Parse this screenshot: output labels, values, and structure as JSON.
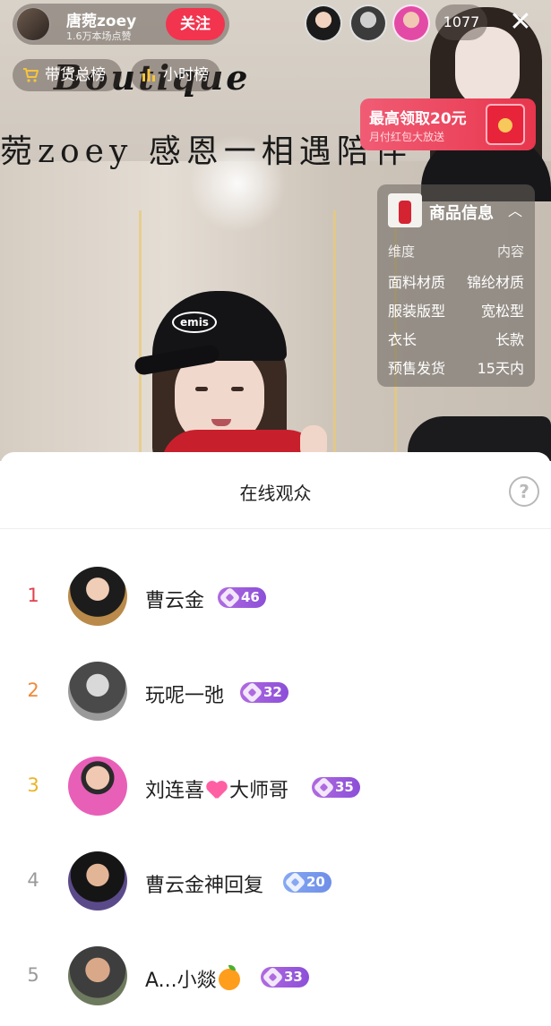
{
  "host": {
    "name": "唐菀zoey",
    "likes": "1.6万本场点赞",
    "follow_label": "关注"
  },
  "top_bar": {
    "viewer_count": "1077",
    "close_glyph": "✕"
  },
  "rank_pills": [
    {
      "label": "带货总榜",
      "icon": "cart-icon"
    },
    {
      "label": "小时榜",
      "icon": "bar-chart-icon"
    }
  ],
  "banner": {
    "script_title": "Boutique",
    "hand_text": "菀zoey 感恩一相遇陪伴"
  },
  "red_packet": {
    "title": "最高领取20元",
    "subtitle": "月付红包大放送"
  },
  "product": {
    "title": "商品信息",
    "header": {
      "k": "维度",
      "v": "内容"
    },
    "specs": [
      {
        "k": "面料材质",
        "v": "锦纶材质"
      },
      {
        "k": "服装版型",
        "v": "宽松型"
      },
      {
        "k": "衣长",
        "v": "长款"
      },
      {
        "k": "预售发货",
        "v": "15天内"
      }
    ]
  },
  "presenter": {
    "cap_text": "emis"
  },
  "audience": {
    "title": "在线观众",
    "help_glyph": "?",
    "rows": [
      {
        "rank": "1",
        "name": "曹云金",
        "level": "46",
        "badge": "purple",
        "rank_color": "#e0424f"
      },
      {
        "rank": "2",
        "name": "玩呢一弛",
        "level": "32",
        "badge": "purple",
        "rank_color": "#ef8a3a"
      },
      {
        "rank": "3",
        "name_pre": "刘连喜",
        "name_post": "大师哥",
        "level": "35",
        "badge": "purple",
        "rank_color": "#e9b425"
      },
      {
        "rank": "4",
        "name": "曹云金神回复",
        "level": "20",
        "badge": "blue",
        "rank_color": "#9a9a9a"
      },
      {
        "rank": "5",
        "name": "A...小燚",
        "level": "33",
        "badge": "purple",
        "rank_color": "#9a9a9a"
      }
    ]
  },
  "colors": {
    "follow": "#f2344f",
    "badge_purple": "#8b4fd8",
    "badge_blue": "#6f8ee8"
  }
}
